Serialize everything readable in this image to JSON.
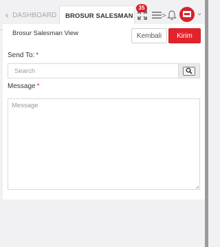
{
  "tabs": {
    "dashboard_label": "DASHBOARD",
    "active_label": "BROSUR SALESMAN VIEW"
  },
  "header": {
    "notification_count": "35",
    "icons": [
      "expand-icon",
      "menu-icon",
      "arrow-right-icon",
      "bell-icon",
      "avatar",
      "chevron-down-icon"
    ],
    "accent_color": "#e3232b"
  },
  "page": {
    "title": "Brosur Salesman View",
    "back_label": "Kembali",
    "send_label": "Kirim"
  },
  "form": {
    "send_to_label": "Send To:",
    "required_mark": "*",
    "search_placeholder": "Search",
    "message_label": "Message",
    "message_placeholder": "Message"
  }
}
